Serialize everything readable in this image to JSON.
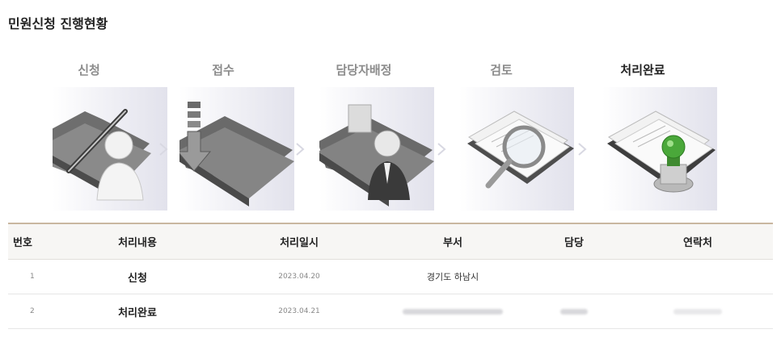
{
  "title": "민원신청 진행현황",
  "steps": [
    {
      "label": "신청",
      "icon": "folder-pen-person-icon",
      "active": false
    },
    {
      "label": "접수",
      "icon": "folder-download-arrow-icon",
      "active": false
    },
    {
      "label": "담당자배정",
      "icon": "folder-person-assign-icon",
      "active": false
    },
    {
      "label": "검토",
      "icon": "documents-magnifier-icon",
      "active": false
    },
    {
      "label": "처리완료",
      "icon": "documents-stamp-icon",
      "active": true
    }
  ],
  "table": {
    "headers": [
      "번호",
      "처리내용",
      "처리일시",
      "부서",
      "담당",
      "연락처"
    ],
    "rows": [
      {
        "no": "1",
        "content": "신청",
        "date": "2023.04.20",
        "dept": "경기도 하남시",
        "manager": "",
        "contact": ""
      },
      {
        "no": "2",
        "content": "처리완료",
        "date": "2023.04.21",
        "dept": "",
        "manager": "",
        "contact": ""
      }
    ]
  },
  "colors": {
    "header_border": "#c9b7a0",
    "header_bg": "#f7f6f4",
    "active_label": "#222222",
    "inactive_label": "#8c8c8c",
    "stamp_green": "#4aa83a"
  }
}
